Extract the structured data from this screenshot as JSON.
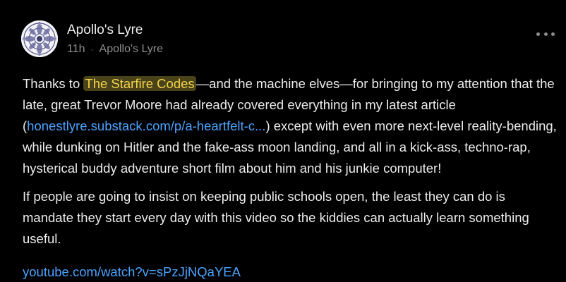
{
  "post": {
    "author_name": "Apollo's Lyre",
    "time_ago": "11h",
    "separator": "·",
    "publication": "Apollo's Lyre",
    "avatar_icon": "mandala-avatar-icon",
    "more_icon": "more-options-icon"
  },
  "body": {
    "p1_before": "Thanks to ",
    "p1_mention": "The Starfire Codes",
    "p1_after_mention": "—and the machine elves—for bringing to my attention that the late, great Trevor Moore had already covered everything in my latest article (",
    "p1_link": "honestlyre.substack.com/p/a-heartfelt-c...",
    "p1_end": ") except with even more next-level reality-bending, while dunking on Hitler and the fake-ass moon landing, and all in a kick-ass, techno-rap, hysterical buddy adventure short film about him and his junkie computer!",
    "p2": "If people are going to insist on keeping public schools open, the least they can do is mandate they start every day with this video so the kiddies can actually learn something useful.",
    "youtube_link": "youtube.com/watch?v=sPzJjNQaYEA"
  },
  "colors": {
    "background": "#000000",
    "text": "#ececec",
    "muted": "#8f8f8f",
    "link": "#4aa3ff",
    "mention_text": "#f2d44a",
    "mention_bg": "#4a431a"
  }
}
